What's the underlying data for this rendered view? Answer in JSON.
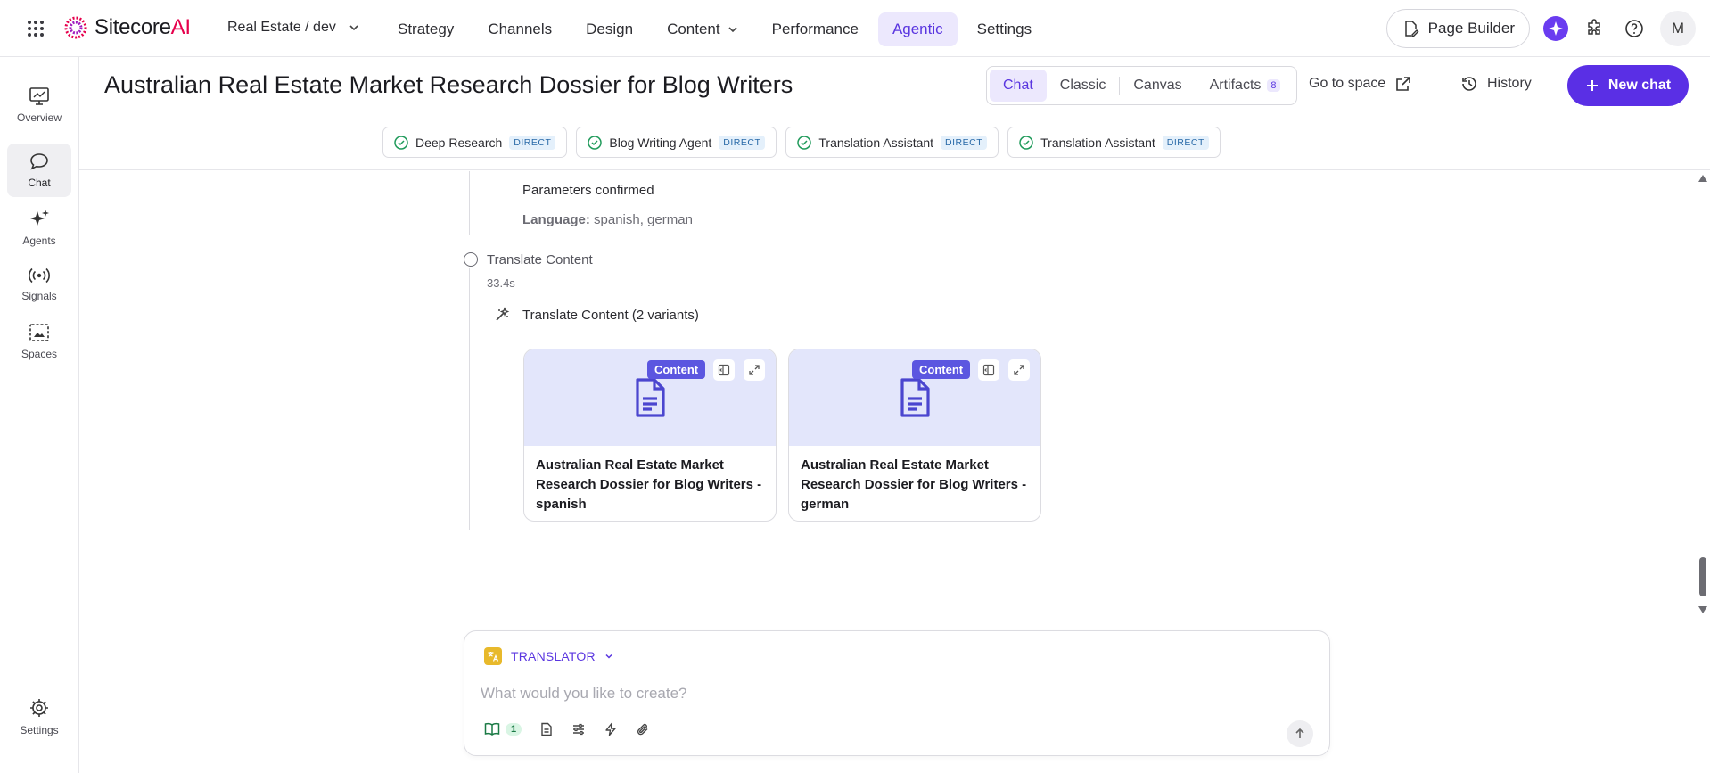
{
  "app": {
    "brand_name": "Sitecore",
    "brand_suffix": "AI",
    "site_switcher": "Real Estate / dev"
  },
  "nav": {
    "items": [
      {
        "label": "Strategy"
      },
      {
        "label": "Channels"
      },
      {
        "label": "Design"
      },
      {
        "label": "Content"
      },
      {
        "label": "Performance"
      },
      {
        "label": "Agentic"
      },
      {
        "label": "Settings"
      }
    ],
    "active": "Agentic"
  },
  "topright": {
    "page_builder": "Page Builder",
    "avatar_initial": "M"
  },
  "sidebar": {
    "items": [
      {
        "label": "Overview"
      },
      {
        "label": "Chat"
      },
      {
        "label": "Agents"
      },
      {
        "label": "Signals"
      },
      {
        "label": "Spaces"
      }
    ],
    "settings": "Settings"
  },
  "header": {
    "title": "Australian Real Estate Market Research Dossier for Blog Writers",
    "tabs": [
      {
        "label": "Chat"
      },
      {
        "label": "Classic"
      },
      {
        "label": "Canvas"
      },
      {
        "label": "Artifacts",
        "count": "8"
      }
    ],
    "go_to_space": "Go to space",
    "history": "History",
    "new_chat": "New chat"
  },
  "agents": [
    {
      "name": "Deep Research",
      "badge": "DIRECT"
    },
    {
      "name": "Blog Writing Agent",
      "badge": "DIRECT"
    },
    {
      "name": "Translation Assistant",
      "badge": "DIRECT"
    },
    {
      "name": "Translation Assistant",
      "badge": "DIRECT"
    }
  ],
  "thread": {
    "params_confirmed": "Parameters confirmed",
    "language_label": "Language:",
    "language_value": "spanish, german",
    "step_label": "Translate Content",
    "step_time": "33.4s",
    "tool_label": "Translate Content (2 variants)",
    "cards": [
      {
        "badge": "Content",
        "title": "Australian Real Estate Market Research Dossier for Blog Writers - spanish"
      },
      {
        "badge": "Content",
        "title": "Australian Real Estate Market Research Dossier for Blog Writers - german"
      }
    ]
  },
  "composer": {
    "agent": "TRANSLATOR",
    "placeholder": "What would you like to create?",
    "knowledge_count": "1"
  },
  "colors": {
    "accent": "#5a2fe5",
    "active_nav_bg": "#ece8fd",
    "card_header_bg": "#e3e6fb"
  }
}
